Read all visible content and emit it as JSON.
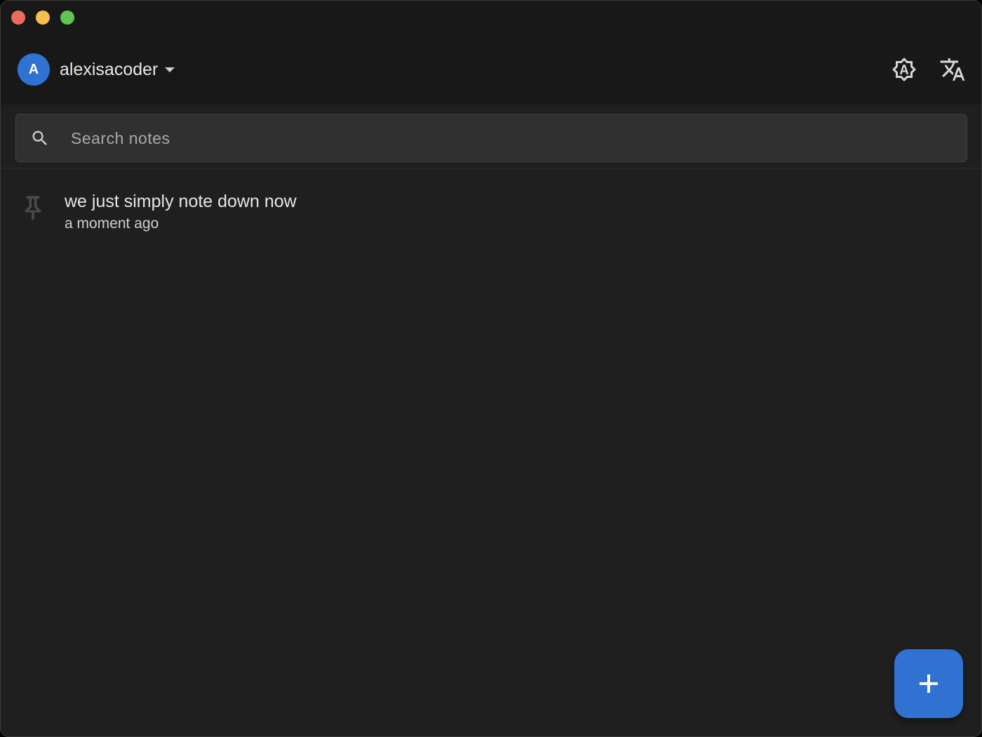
{
  "window": {
    "controls": [
      "close",
      "minimize",
      "maximize"
    ]
  },
  "colors": {
    "accent": "#2f72d2",
    "background": "#1f1f1f",
    "titlebar": "#181818",
    "traffic_close": "#ed6a5e",
    "traffic_minimize": "#f5bf4f",
    "traffic_maximize": "#61c554"
  },
  "header": {
    "avatar_letter": "A",
    "username": "alexisacoder",
    "theme_icon": "auto-brightness-icon",
    "language_icon": "translate-icon"
  },
  "search": {
    "placeholder": "Search notes",
    "value": "",
    "icon": "search-icon"
  },
  "notes": [
    {
      "title": "we just simply note down now",
      "time": "a moment ago",
      "pinned": false,
      "icon": "pin-icon"
    }
  ],
  "fab": {
    "label": "+",
    "icon": "plus-icon"
  }
}
